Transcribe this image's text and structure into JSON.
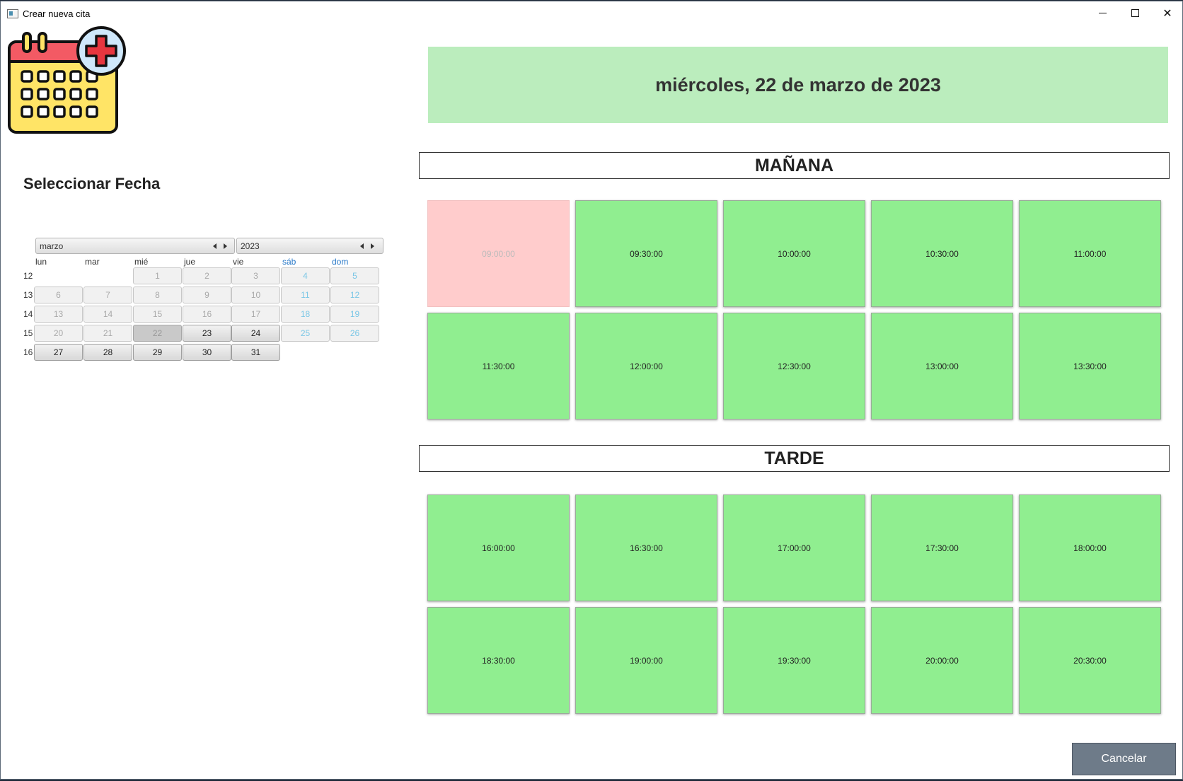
{
  "window": {
    "title": "Crear nueva cita"
  },
  "calendar_logo": {
    "icon": "calendar-add-icon",
    "colors": {
      "header": "#f35a64",
      "body": "#ffe466",
      "plus": "#e8363f",
      "badge": "#cfe8fb"
    }
  },
  "selector": {
    "title": "Seleccionar Fecha",
    "month": "marzo",
    "year": "2023",
    "weekdays": [
      "lun",
      "mar",
      "mié",
      "jue",
      "vie",
      "sáb",
      "dom"
    ],
    "weeks": [
      {
        "week": "12",
        "days": [
          "",
          "",
          "1",
          "2",
          "3",
          "4",
          "5"
        ]
      },
      {
        "week": "13",
        "days": [
          "6",
          "7",
          "8",
          "9",
          "10",
          "11",
          "12"
        ]
      },
      {
        "week": "14",
        "days": [
          "13",
          "14",
          "15",
          "16",
          "17",
          "18",
          "19"
        ]
      },
      {
        "week": "15",
        "days": [
          "20",
          "21",
          "22",
          "23",
          "24",
          "25",
          "26"
        ]
      },
      {
        "week": "16",
        "days": [
          "27",
          "28",
          "29",
          "30",
          "31",
          "",
          ""
        ]
      }
    ],
    "selected_day": "22",
    "available_days": [
      "23",
      "24",
      "27",
      "28",
      "29",
      "30",
      "31"
    ]
  },
  "selected_date_label": "miércoles, 22 de marzo de 2023",
  "morning": {
    "title": "MAÑANA",
    "slots": [
      {
        "time": "09:00:00",
        "available": false
      },
      {
        "time": "09:30:00",
        "available": true
      },
      {
        "time": "10:00:00",
        "available": true
      },
      {
        "time": "10:30:00",
        "available": true
      },
      {
        "time": "11:00:00",
        "available": true
      },
      {
        "time": "11:30:00",
        "available": true
      },
      {
        "time": "12:00:00",
        "available": true
      },
      {
        "time": "12:30:00",
        "available": true
      },
      {
        "time": "13:00:00",
        "available": true
      },
      {
        "time": "13:30:00",
        "available": true
      }
    ]
  },
  "afternoon": {
    "title": "TARDE",
    "slots": [
      {
        "time": "16:00:00",
        "available": true
      },
      {
        "time": "16:30:00",
        "available": true
      },
      {
        "time": "17:00:00",
        "available": true
      },
      {
        "time": "17:30:00",
        "available": true
      },
      {
        "time": "18:00:00",
        "available": true
      },
      {
        "time": "18:30:00",
        "available": true
      },
      {
        "time": "19:00:00",
        "available": true
      },
      {
        "time": "19:30:00",
        "available": true
      },
      {
        "time": "20:00:00",
        "available": true
      },
      {
        "time": "20:30:00",
        "available": true
      }
    ]
  },
  "actions": {
    "cancel_label": "Cancelar"
  },
  "colors": {
    "available": "#90ee90",
    "busy": "#ffcccc",
    "banner": "#bbedbd",
    "cancel": "#6e7b89"
  }
}
